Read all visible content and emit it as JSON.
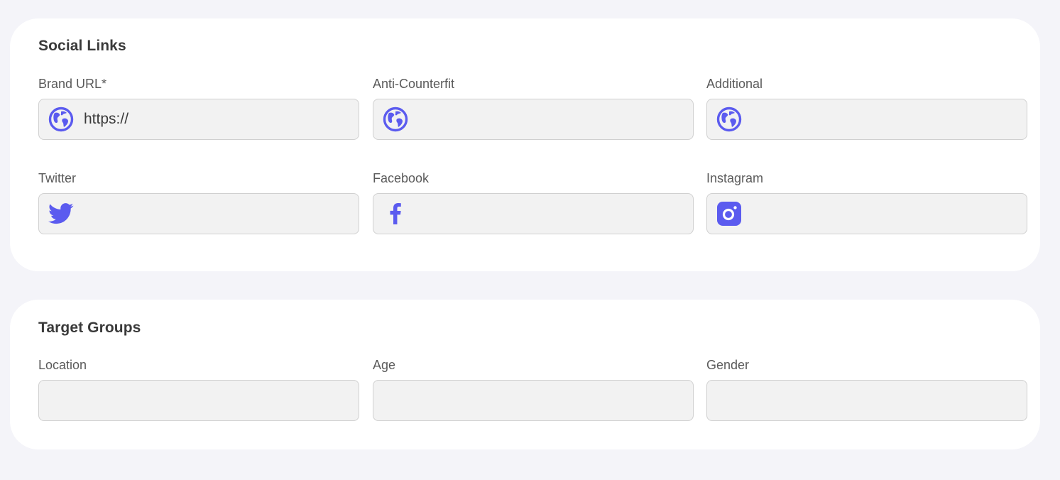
{
  "social": {
    "title": "Social Links",
    "fields": [
      {
        "label": "Brand URL*",
        "value": "https://",
        "icon": "globe-icon"
      },
      {
        "label": "Anti-Counterfit",
        "value": "",
        "icon": "globe-icon"
      },
      {
        "label": "Additional",
        "value": "",
        "icon": "globe-icon"
      },
      {
        "label": "Twitter",
        "value": "",
        "icon": "twitter-icon"
      },
      {
        "label": "Facebook",
        "value": "",
        "icon": "facebook-icon"
      },
      {
        "label": "Instagram",
        "value": "",
        "icon": "instagram-icon"
      }
    ]
  },
  "target": {
    "title": "Target Groups",
    "fields": [
      {
        "label": "Location",
        "value": ""
      },
      {
        "label": "Age",
        "value": ""
      },
      {
        "label": "Gender",
        "value": ""
      }
    ]
  },
  "colors": {
    "accent": "#5b5bef",
    "background": "#f4f4f9",
    "card": "#ffffff",
    "input_bg": "#f2f2f2",
    "input_border": "#d0d0d0"
  }
}
